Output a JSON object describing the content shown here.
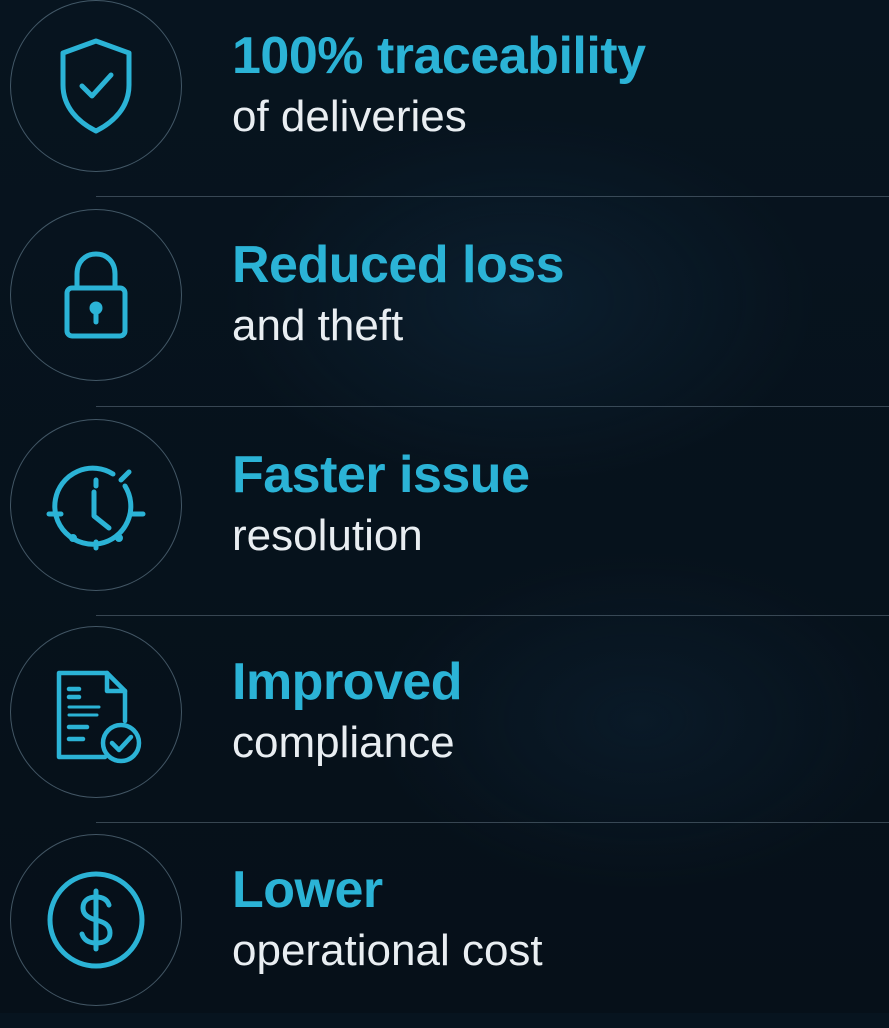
{
  "accent_color": "#2bb3d6",
  "text_color": "#e9eef2",
  "background_color": "#07131f",
  "benefits": [
    {
      "icon": "shield-check-icon",
      "headline": "100% traceability",
      "subline": "of deliveries"
    },
    {
      "icon": "padlock-icon",
      "headline": "Reduced loss",
      "subline": "and theft"
    },
    {
      "icon": "stopwatch-icon",
      "headline": "Faster issue",
      "subline": "resolution"
    },
    {
      "icon": "document-check-icon",
      "headline": "Improved",
      "subline": "compliance"
    },
    {
      "icon": "dollar-coin-icon",
      "headline": "Lower",
      "subline": "operational cost"
    }
  ]
}
